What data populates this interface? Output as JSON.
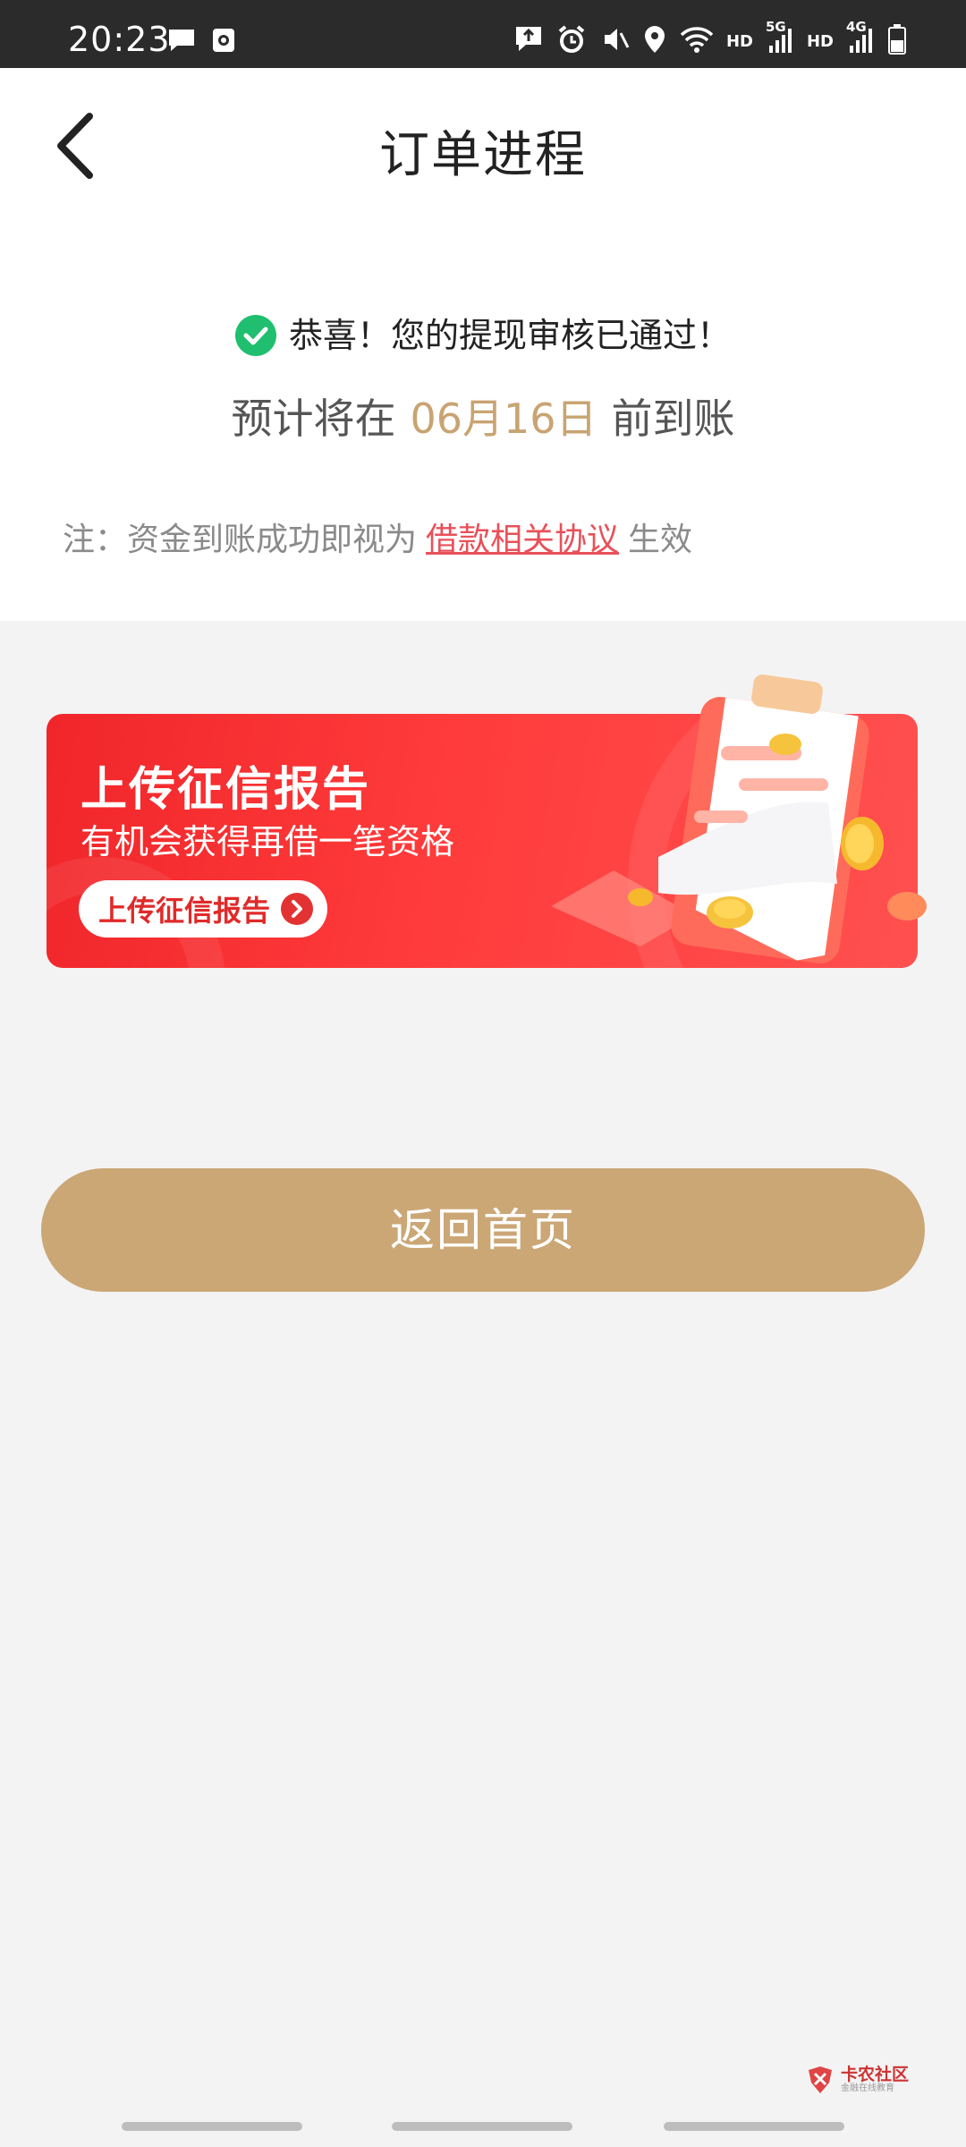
{
  "status_bar": {
    "time": "20:23",
    "left_icons": [
      "message-icon",
      "camera-notification-icon"
    ],
    "right_icons": [
      "upload-notification-icon",
      "alarm-icon",
      "vibrate-icon",
      "location-icon",
      "wifi-icon",
      "signal-5g-icon",
      "signal-4g-icon",
      "battery-icon"
    ],
    "hd1": "HD",
    "net1": "5G",
    "hd2": "HD",
    "net2": "4G"
  },
  "header": {
    "title": "订单进程",
    "back_icon": "chevron-left-icon"
  },
  "info": {
    "approval_text": "恭喜！您的提现审核已通过！",
    "estimate_prefix": "预计将在",
    "estimate_date": "06月16日",
    "estimate_suffix": "前到账",
    "note_prefix": "注：资金到账成功即视为",
    "note_link": "借款相关协议",
    "note_suffix": "生效"
  },
  "banner": {
    "title": "上传征信报告",
    "subtitle": "有机会获得再借一笔资格",
    "button_label": "上传征信报告"
  },
  "actions": {
    "home_button": "返回首页"
  },
  "watermark": {
    "main": "卡农社区",
    "sub": "金融在线教育"
  },
  "colors": {
    "accent_gold": "#cba776",
    "date_gold": "#c8a472",
    "success_green": "#1fbf6f",
    "banner_red": "#f0262a",
    "link_red": "#e8515a"
  }
}
